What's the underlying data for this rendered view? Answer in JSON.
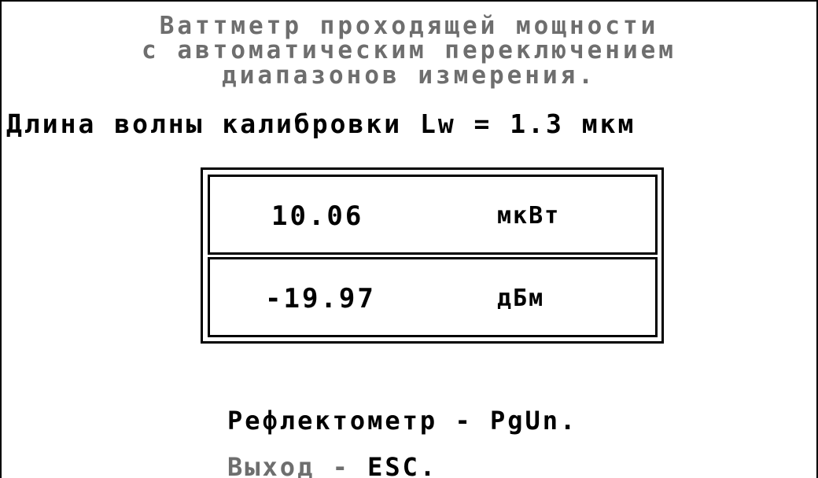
{
  "title": {
    "line1": "Ваттметр проходящей мощности",
    "line2": "с автоматическим переключением",
    "line3": "диапазонов измерения."
  },
  "calibration": {
    "text": "Длина волны калибровки Lw = 1.3 мкм"
  },
  "readout": {
    "power": {
      "value": "10.06",
      "unit": "мкВт"
    },
    "level": {
      "value": "-19.97",
      "unit": "дБм"
    }
  },
  "menu": {
    "reflectometer": {
      "label": "Рефлектометр",
      "separator": "-",
      "key": "PgUn."
    },
    "exit": {
      "label": "Выход",
      "separator": "-",
      "key": "ESC."
    }
  },
  "colors": {
    "primary": "#000000",
    "dim": "#6e6e6e",
    "background": "#ffffff"
  }
}
